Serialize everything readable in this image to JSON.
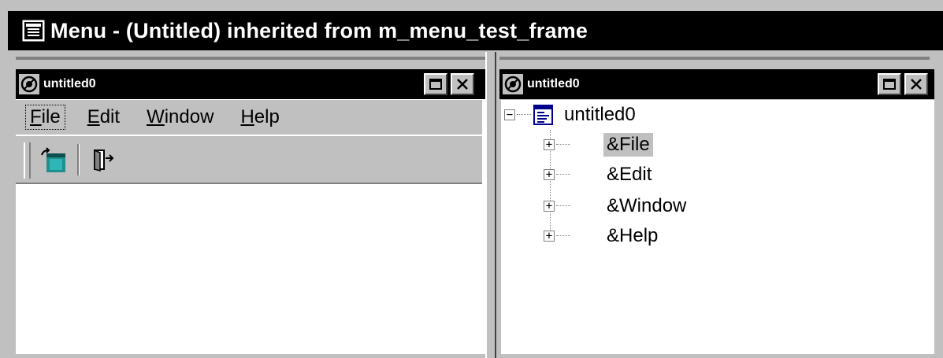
{
  "window": {
    "title": "Menu - (Untitled) inherited from m_menu_test_frame"
  },
  "left_pane": {
    "title": "untitled0",
    "menubar": [
      {
        "label": "File",
        "mnemonic": "F",
        "rest": "ile",
        "active": true
      },
      {
        "label": "Edit",
        "mnemonic": "E",
        "rest": "dit",
        "active": false
      },
      {
        "label": "Window",
        "mnemonic": "W",
        "rest": "indow",
        "active": false
      },
      {
        "label": "Help",
        "mnemonic": "H",
        "rest": "elp",
        "active": false
      }
    ],
    "toolbar": {
      "buttons": [
        "window-box-icon",
        "exit-door-icon"
      ]
    }
  },
  "right_pane": {
    "title": "untitled0",
    "tree": {
      "root": "untitled0",
      "children": [
        "&File",
        "&Edit",
        "&Window",
        "&Help"
      ],
      "selected": "&File"
    }
  },
  "colors": {
    "titlebar_bg": "#000000",
    "face": "#c0c0c0",
    "client": "#ffffff",
    "tree_selection": "#c0c0c0"
  }
}
